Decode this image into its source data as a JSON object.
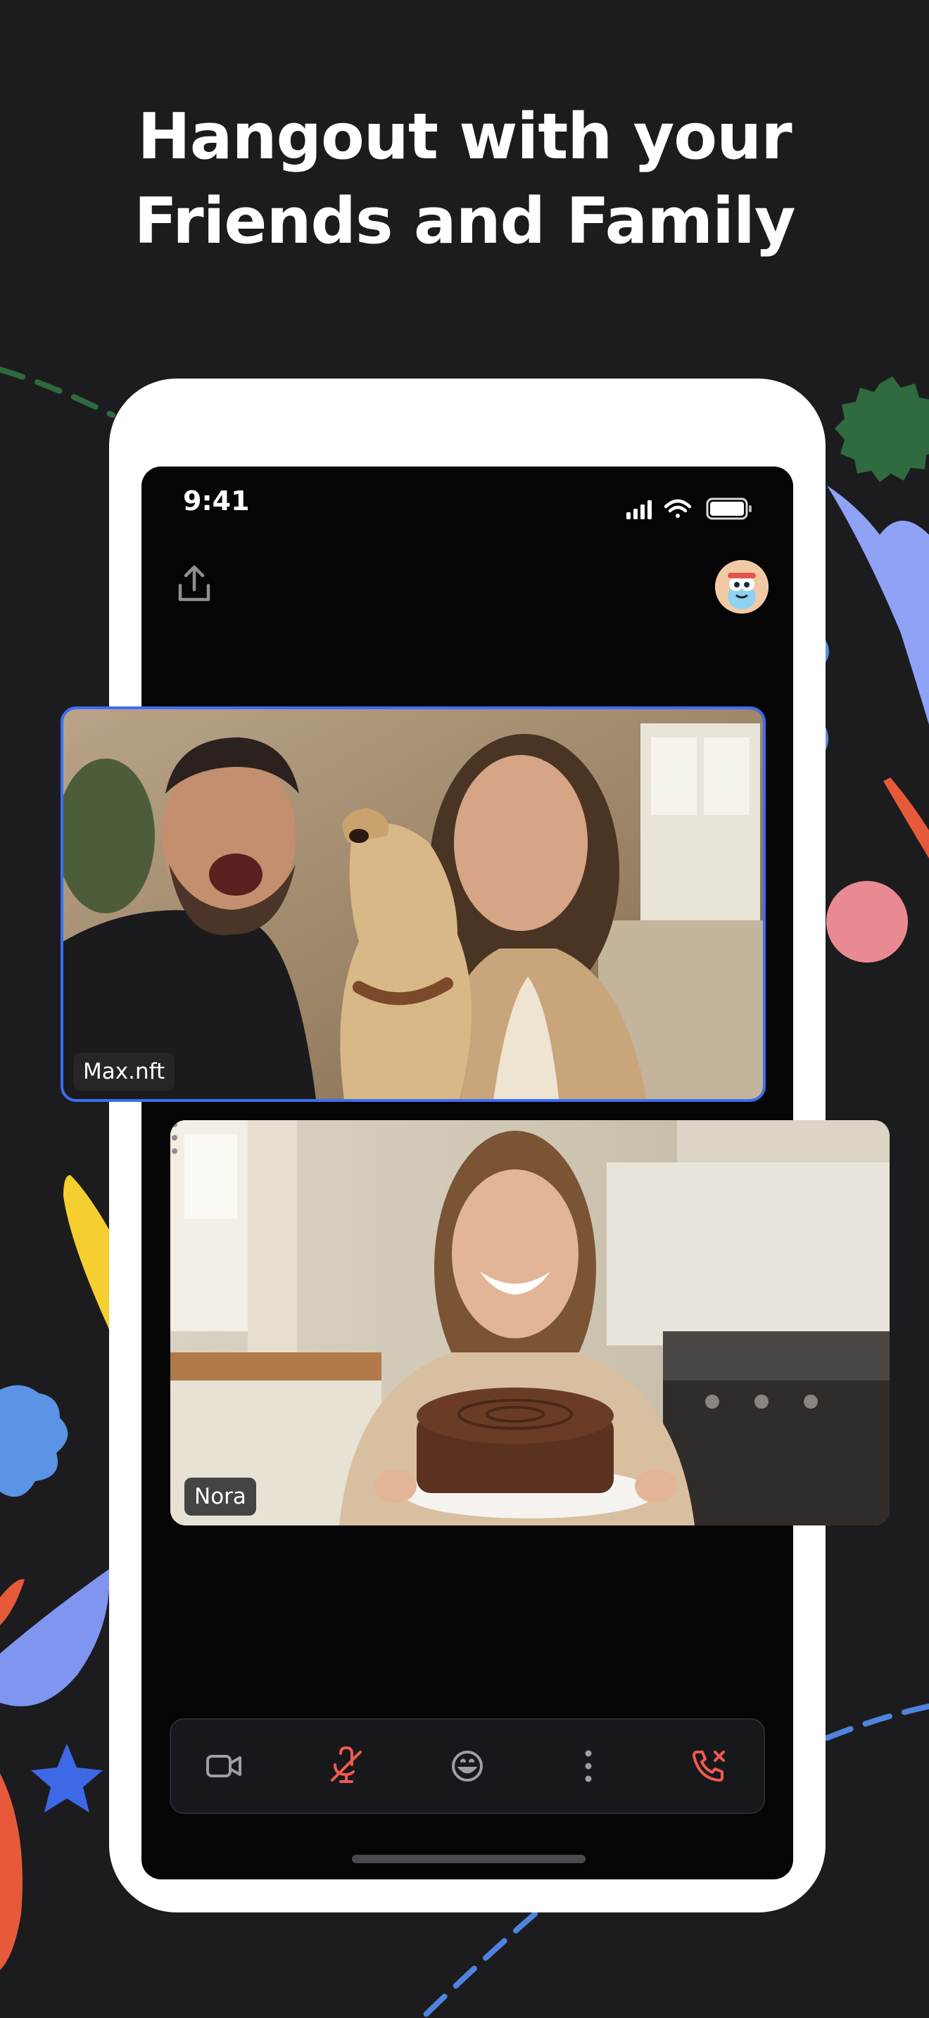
{
  "headline": {
    "line1": "Hangout with your",
    "line2": "Friends and Family"
  },
  "status_bar": {
    "time": "9:41",
    "icons": [
      "signal-icon",
      "wifi-icon",
      "battery-icon"
    ]
  },
  "top_bar": {
    "share_icon": "share-icon",
    "avatar": "avatar"
  },
  "participants": [
    {
      "name": "Max.nft",
      "active_speaker": true,
      "border_color": "#3b6ef5"
    },
    {
      "name": "Nora",
      "active_speaker": false
    }
  ],
  "call_controls": [
    {
      "icon": "video-camera-icon",
      "color": "#9aa0a6"
    },
    {
      "icon": "microphone-muted-icon",
      "color": "#ef5a4f"
    },
    {
      "icon": "emoji-icon",
      "color": "#9aa0a6"
    },
    {
      "icon": "more-vertical-icon",
      "color": "#9aa0a6"
    },
    {
      "icon": "end-call-icon",
      "color": "#ef5a4f"
    }
  ],
  "colors": {
    "background": "#1c1c1e",
    "accent_blue": "#3b6ef5",
    "danger_red": "#ef5a4f"
  }
}
